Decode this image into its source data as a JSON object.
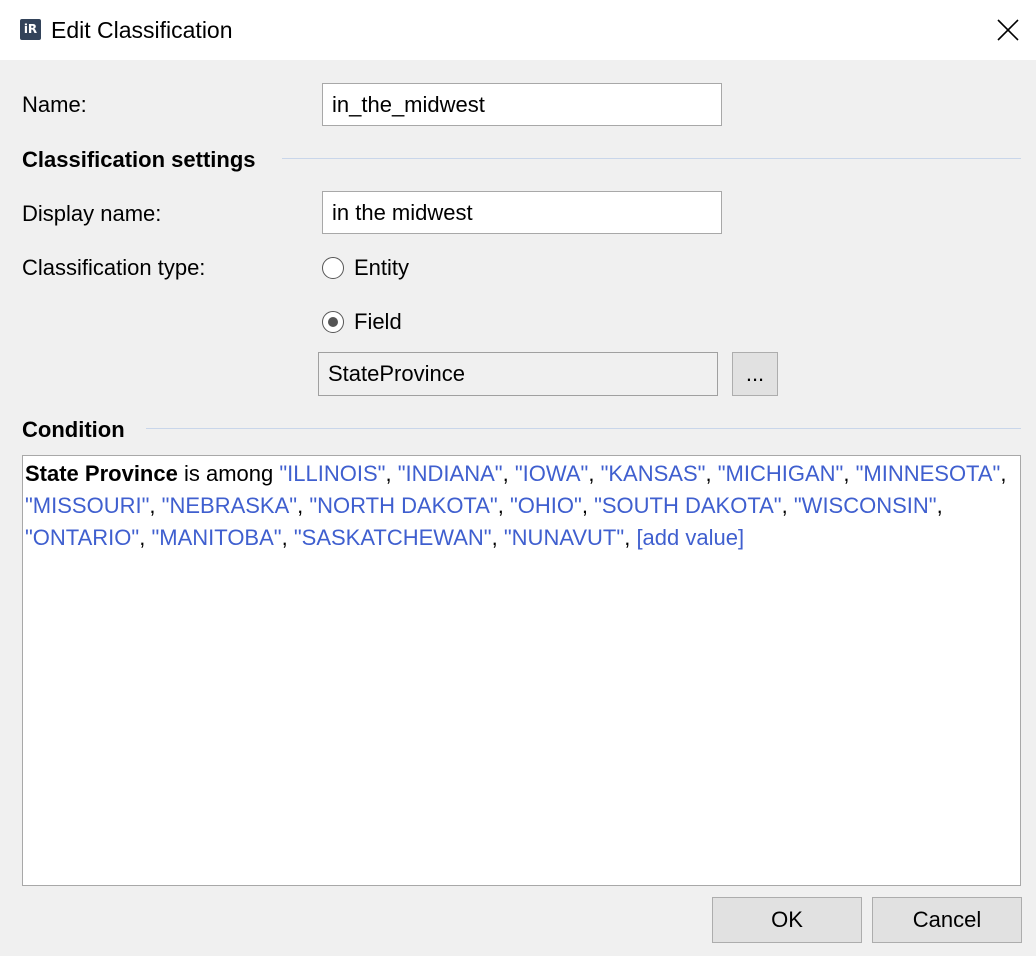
{
  "window": {
    "title": "Edit Classification",
    "icon": "ir-app-icon",
    "close_icon": "close-icon"
  },
  "form": {
    "name_label": "Name:",
    "name_value": "in_the_midwest",
    "settings_title": "Classification settings",
    "display_name_label": "Display name:",
    "display_name_value": "in the midwest",
    "type_label": "Classification type:",
    "type_options": [
      {
        "label": "Entity",
        "selected": false
      },
      {
        "label": "Field",
        "selected": true
      }
    ],
    "field_value": "StateProvince",
    "browse_label": "..."
  },
  "condition": {
    "title": "Condition",
    "field": "State Province",
    "operator": "is among",
    "values": [
      "\"ILLINOIS\"",
      "\"INDIANA\"",
      "\"IOWA\"",
      "\"KANSAS\"",
      "\"MICHIGAN\"",
      "\"MINNESOTA\"",
      "\"MISSOURI\"",
      "\"NEBRASKA\"",
      "\"NORTH DAKOTA\"",
      "\"OHIO\"",
      "\"SOUTH DAKOTA\"",
      "\"WISCONSIN\"",
      "\"ONTARIO\"",
      "\"MANITOBA\"",
      "\"SASKATCHEWAN\"",
      "\"NUNAVUT\""
    ],
    "separator": ",",
    "add_value": "[add value]"
  },
  "buttons": {
    "ok": "OK",
    "cancel": "Cancel"
  },
  "colors": {
    "value_link": "#3f5fcf",
    "section_line": "#c9d6ea",
    "background": "#f0f0f0"
  }
}
